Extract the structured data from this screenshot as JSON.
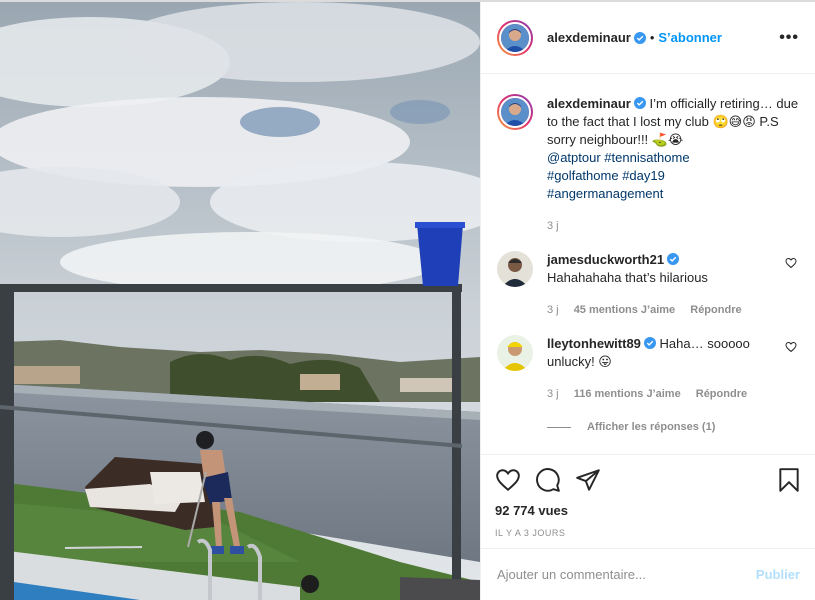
{
  "header": {
    "username": "alexdeminaur",
    "separator": "•",
    "follow_label": "S’abonner",
    "more_label": "•••"
  },
  "caption": {
    "username": "alexdeminaur",
    "text": "I’m officially retiring… due to the fact that I lost my club 🙄😅😡 P.S sorry neighbour!!! ⛳😭",
    "mention": "@atptour",
    "hashtags": [
      "#tennisathome",
      "#golfathome",
      "#day19",
      "#angermanagement"
    ],
    "time": "3 j"
  },
  "comments": [
    {
      "username": "jamesduckworth21",
      "text": "Hahahahaha that’s hilarious",
      "time": "3 j",
      "likes": "45 mentions J’aime",
      "reply": "Répondre"
    },
    {
      "username": "lleytonhewitt89",
      "text": "Haha… sooooo unlucky! 😛",
      "time": "3 j",
      "likes": "116 mentions J’aime",
      "reply": "Répondre"
    }
  ],
  "replies_label": "Afficher les réponses (1)",
  "stats": {
    "views": "92 774 vues",
    "ago": "IL Y A 3 JOURS"
  },
  "composer": {
    "placeholder": "Ajouter un commentaire...",
    "post_label": "Publier"
  },
  "icons": {
    "like": "heart-icon",
    "comment": "comment-icon",
    "share": "share-icon",
    "save": "bookmark-icon",
    "verified": "verified-badge-icon"
  },
  "colors": {
    "accent": "#0095f6",
    "verified": "#3897f0",
    "muted": "#8e8e8e",
    "post_disabled": "#b2dffc"
  }
}
